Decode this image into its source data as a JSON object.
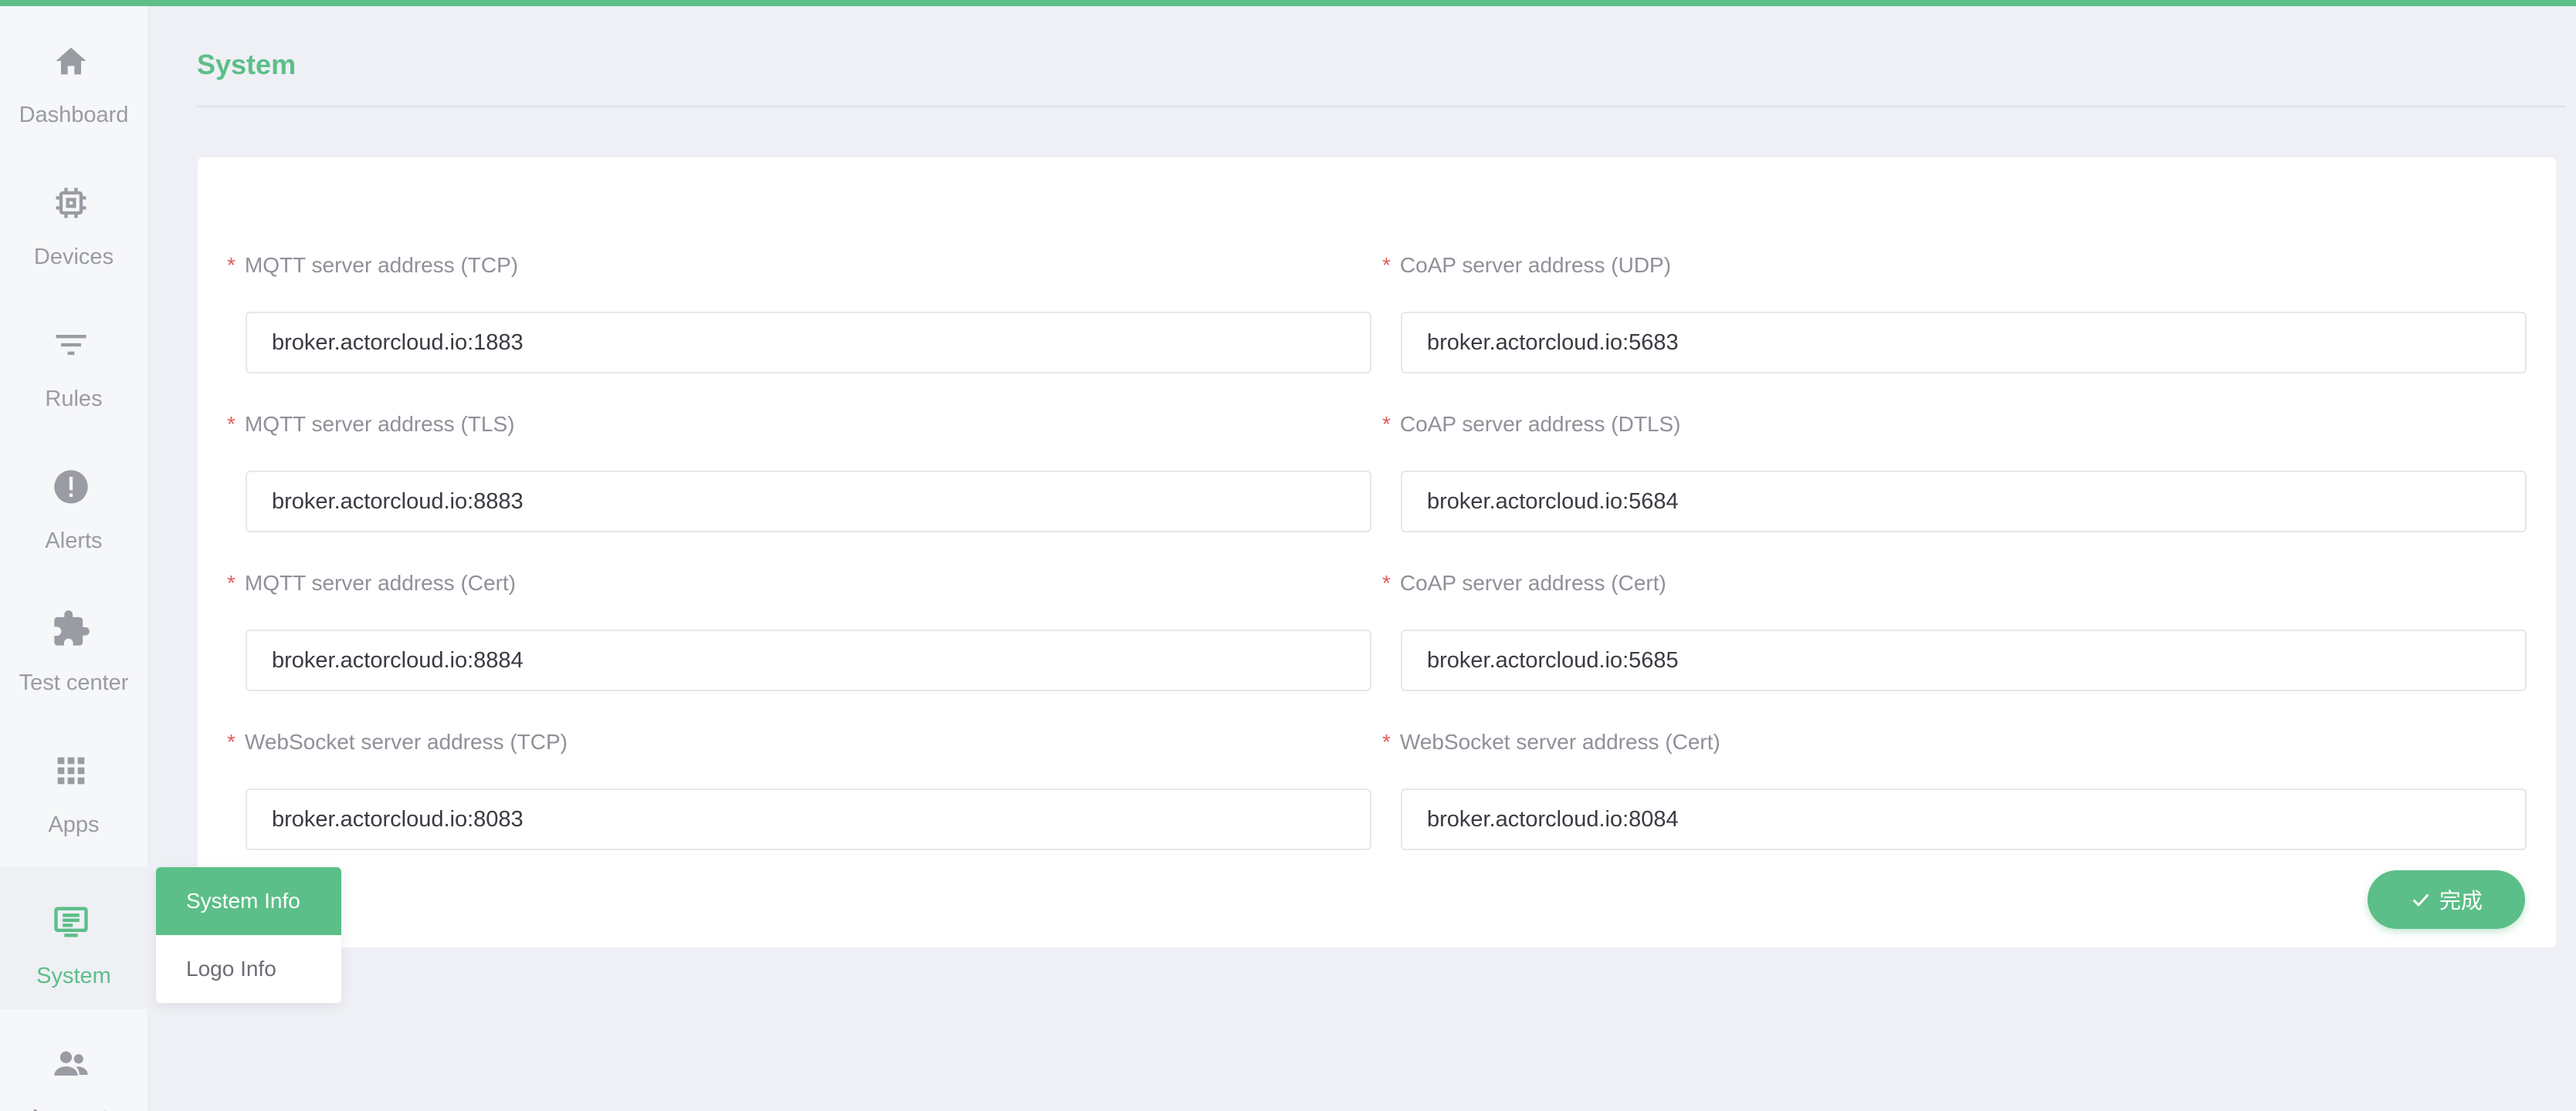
{
  "colors": {
    "accent": "#5cbe88",
    "required": "#e35c5c",
    "background": "#eef0f5"
  },
  "sidebar": {
    "items": [
      {
        "label": "Dashboard",
        "icon": "home-icon",
        "active": false
      },
      {
        "label": "Devices",
        "icon": "chip-icon",
        "active": false
      },
      {
        "label": "Rules",
        "icon": "filter-icon",
        "active": false
      },
      {
        "label": "Alerts",
        "icon": "alert-icon",
        "active": false
      },
      {
        "label": "Test center",
        "icon": "puzzle-icon",
        "active": false
      },
      {
        "label": "Apps",
        "icon": "apps-grid-icon",
        "active": false
      },
      {
        "label": "System",
        "icon": "monitor-icon",
        "active": true
      },
      {
        "label": "Accounts",
        "icon": "people-icon",
        "active": false
      }
    ]
  },
  "page": {
    "title": "System"
  },
  "form": {
    "required_mark": "*",
    "fields": [
      {
        "label": "MQTT server address (TCP)",
        "value": "broker.actorcloud.io:1883"
      },
      {
        "label": "CoAP server address (UDP)",
        "value": "broker.actorcloud.io:5683"
      },
      {
        "label": "MQTT server address (TLS)",
        "value": "broker.actorcloud.io:8883"
      },
      {
        "label": "CoAP server address (DTLS)",
        "value": "broker.actorcloud.io:5684"
      },
      {
        "label": "MQTT server address (Cert)",
        "value": "broker.actorcloud.io:8884"
      },
      {
        "label": "CoAP server address (Cert)",
        "value": "broker.actorcloud.io:5685"
      },
      {
        "label": "WebSocket server address (TCP)",
        "value": "broker.actorcloud.io:8083"
      },
      {
        "label": "WebSocket server address (Cert)",
        "value": "broker.actorcloud.io:8084"
      }
    ],
    "done_label": "完成",
    "done_icon": "check-icon"
  },
  "submenu": {
    "items": [
      {
        "label": "System Info",
        "active": true
      },
      {
        "label": "Logo Info",
        "active": false
      }
    ]
  }
}
